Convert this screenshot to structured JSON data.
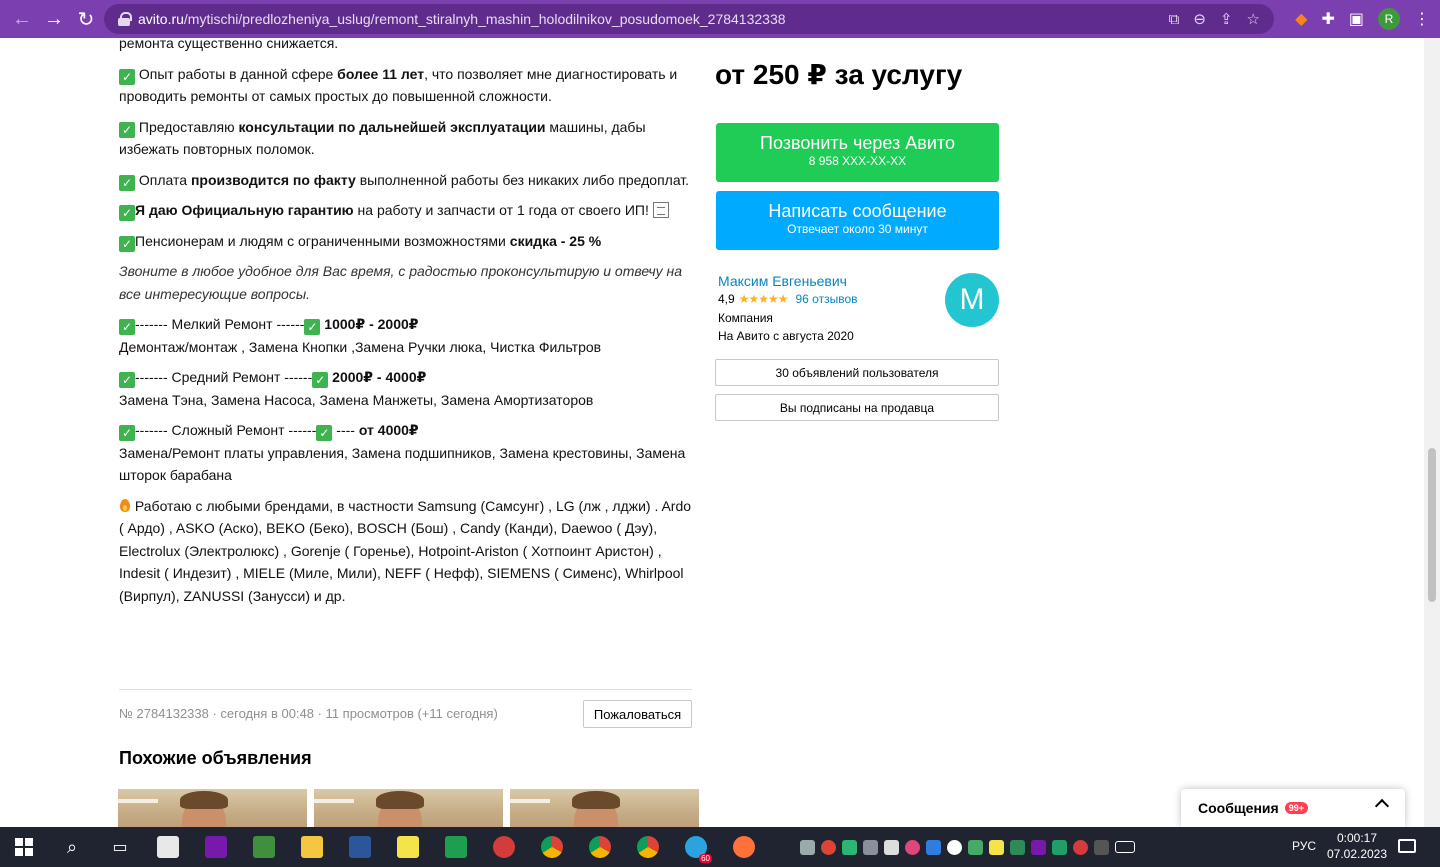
{
  "browser": {
    "url_host": "avito.ru",
    "url_path": "/mytischi/predlozheniya_uslug/remont_stiralnyh_mashin_holodilnikov_posudomoek_2784132338",
    "profile_initial": "R"
  },
  "description": {
    "cut_line": "ремонта существенно снижается.",
    "p1_pre": " Опыт работы в данной сфере ",
    "p1_bold": "более 11 лет",
    "p1_post": ", что позволяет мне диагностировать и проводить ремонты от самых простых до повышенной сложности.",
    "p2_pre": " Предоставляю ",
    "p2_bold": "консультации по дальнейшей эксплуатации",
    "p2_post": " машины, дабы избежать повторных поломок.",
    "p3_pre": " Оплата ",
    "p3_bold": "производится по факту",
    "p3_post": " выполненной работы без никаких либо предоплат.",
    "p4_bold": "Я даю Официальную гарантию",
    "p4_post": " на работу и запчасти от 1 года от своего ИП! ",
    "p5_pre": "Пенсионерам и людям с ограниченными возможностями ",
    "p5_bold": "скидка - 25 %",
    "p6_italic": "Звоните в любое удобное для Вас время, с радостью проконсультирую и отвечу на все интересующие вопросы.",
    "r1_pre": "------- Мелкий Ремонт ------",
    "r1_bold": " 1000₽ - 2000₽",
    "r1_list": "Демонтаж/монтаж , Замена Кнопки ,Замена Ручки люка, Чистка Фильтров",
    "r2_pre": "------- Средний Ремонт ------",
    "r2_bold": " 2000₽ - 4000₽",
    "r2_list": "Замена Тэна, Замена Насоса, Замена Манжеты, Замена Амортизаторов",
    "r3_pre": "------- Сложный Ремонт ------",
    "r3_mid": " ---- ",
    "r3_bold": "от 4000₽",
    "r3_list": "Замена/Ремонт платы управления, Замена подшипников, Замена крестовины, Замена шторок барабана",
    "brands": " Работаю с любыми брендами, в частности Samsung (Самсунг) , LG (лж , лджи) . Ardo ( Ардо) , ASKO (Аско), BEKO (Беко), BOSCH (Бош) , Candy (Канди), Daewoo ( Дэу), Electrolux (Электролюкс) , Gorenje ( Горенье), Hotpoint-Ariston ( Хотпоинт Аристон) , Indesit ( Индезит) , MIELE (Миле, Мили), NEFF ( Нефф), SIEMENS ( Сименс), Whirlpool (Вирпул), ZANUSSI (Занусси) и др."
  },
  "meta": {
    "info": "№ 2784132338 · сегодня в 00:48 · 11 просмотров (+11 сегодня)",
    "report_label": "Пожаловаться"
  },
  "similar": {
    "title": "Похожие объявления"
  },
  "sidebar": {
    "price": "от 250 ₽ за услугу",
    "call_label": "Позвонить через Авито",
    "call_phone": "8 958 XXX-XX-XX",
    "message_label": "Написать сообщение",
    "message_sub": "Отвечает около 30 минут",
    "seller_name": "Максим Евгеньевич",
    "rating_value": "4,9",
    "stars": "★★★★★",
    "reviews": "96 отзывов",
    "seller_type": "Компания",
    "seller_since": "На Авито с августа 2020",
    "avatar_letter": "M",
    "listings_btn": "30 объявлений пользователя",
    "subscribed_btn": "Вы подписаны на продавца"
  },
  "messages_widget": {
    "label": "Сообщения",
    "badge": "99+"
  },
  "taskbar": {
    "lang": "РУС",
    "time": "0:00:17",
    "date": "07.02.2023",
    "telegram_badge": "60"
  },
  "colors": {
    "chrome": "#7c3fb0",
    "call_green": "#1fcc55",
    "message_blue": "#00aaff",
    "link_blue": "#0a84c1",
    "avatar_teal": "#23c5d0",
    "check_green": "#3fb34f"
  }
}
